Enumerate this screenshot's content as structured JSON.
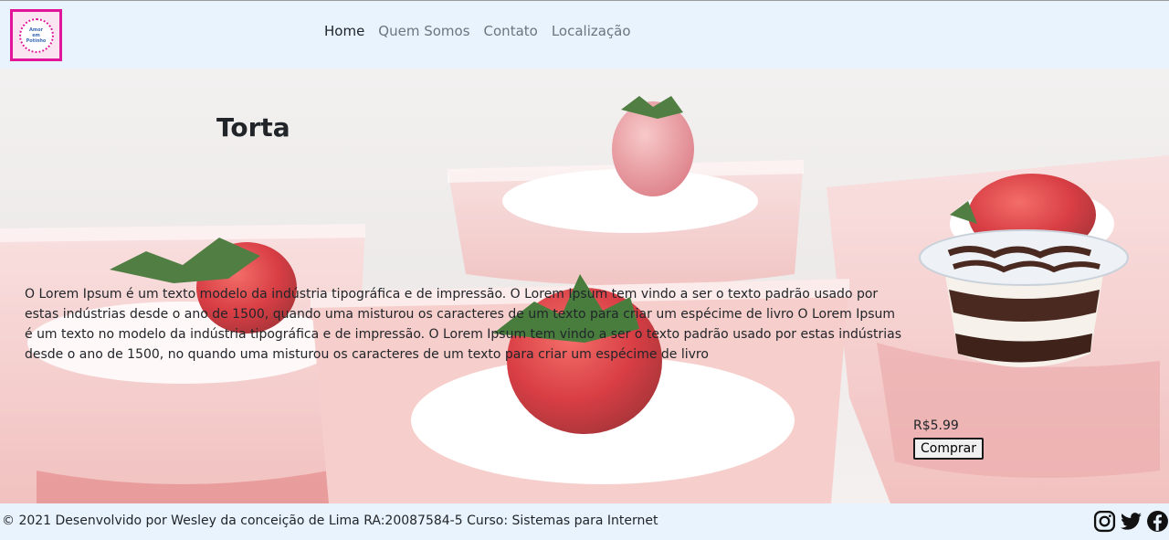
{
  "navbar": {
    "logo_text": [
      "Amor",
      "em",
      "Potinho"
    ],
    "links": [
      {
        "label": "Home",
        "active": true
      },
      {
        "label": "Quem Somos",
        "active": false
      },
      {
        "label": "Contato",
        "active": false
      },
      {
        "label": "Localização",
        "active": false
      }
    ]
  },
  "hero": {
    "title": "Torta",
    "description": "O Lorem Ipsum é um texto modelo da indústria tipográfica e de impressão. O Lorem Ipsum tem vindo a ser o texto padrão usado por estas indústrias desde o ano de 1500, quando uma misturou os caracteres de um texto para criar um espécime de livro O Lorem Ipsum é um texto no modelo da indústria tipográfica e de impressão. O Lorem Ipsum tem vindo a ser o texto padrão usado por estas indústrias desde o ano de 1500, no quando uma misturou os caracteres de um texto para criar um espécime de livro"
  },
  "product": {
    "price": "R$5.99",
    "buy_label": "Comprar"
  },
  "footer": {
    "text": "© 2021 Desenvolvido por Wesley da conceição de Lima RA:20087584-5 Curso: Sistemas para Internet",
    "social_icons": [
      "instagram-icon",
      "twitter-icon",
      "facebook-icon"
    ]
  },
  "colors": {
    "navbar_bg": "#e8f3fd",
    "logo_bg": "#e0159a",
    "strawberry": "#d8282e",
    "cream_pink": "#f3c6c4"
  }
}
